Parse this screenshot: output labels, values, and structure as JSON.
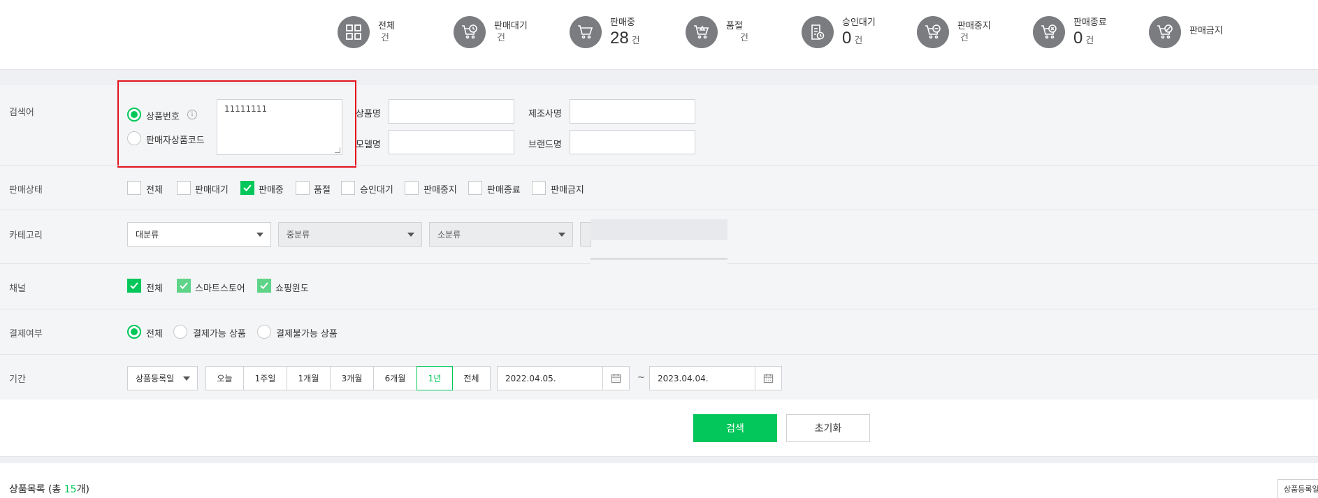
{
  "status_summary": [
    {
      "label": "전체",
      "value": "",
      "unit": "건",
      "icon": "grid-icon"
    },
    {
      "label": "판매대기",
      "value": "",
      "unit": "건",
      "icon": "cart-clock-icon"
    },
    {
      "label": "판매중",
      "value": "28",
      "unit": "건",
      "icon": "cart-icon"
    },
    {
      "label": "품절",
      "value": "",
      "unit": "건",
      "icon": "cart-soldout-icon"
    },
    {
      "label": "승인대기",
      "value": "0",
      "unit": "건",
      "icon": "doc-clock-icon"
    },
    {
      "label": "판매중지",
      "value": "",
      "unit": "건",
      "icon": "cart-minus-icon"
    },
    {
      "label": "판매종료",
      "value": "0",
      "unit": "건",
      "icon": "cart-x-icon"
    },
    {
      "label": "판매금지",
      "value": "",
      "unit": "",
      "icon": "cart-ban-icon"
    }
  ],
  "search": {
    "row_label": "검색어",
    "type_options": [
      {
        "label": "상품번호",
        "selected": true
      },
      {
        "label": "판매자상품코드",
        "selected": false
      }
    ],
    "product_number_value": "11111111",
    "fields": {
      "product_name_label": "상품명",
      "manufacturer_label": "제조사명",
      "model_name_label": "모델명",
      "brand_name_label": "브랜드명"
    }
  },
  "sale_status": {
    "row_label": "판매상태",
    "options": [
      {
        "label": "전체",
        "checked": false
      },
      {
        "label": "판매대기",
        "checked": false
      },
      {
        "label": "판매중",
        "checked": true
      },
      {
        "label": "품절",
        "checked": false
      },
      {
        "label": "승인대기",
        "checked": false
      },
      {
        "label": "판매중지",
        "checked": false
      },
      {
        "label": "판매종료",
        "checked": false
      },
      {
        "label": "판매금지",
        "checked": false
      }
    ]
  },
  "category": {
    "row_label": "카테고리",
    "large": "대분류",
    "medium": "중분류",
    "small": "소분류"
  },
  "channel": {
    "row_label": "채널",
    "options": [
      {
        "label": "전체",
        "checked": true
      },
      {
        "label": "스마트스토어",
        "checked": true
      },
      {
        "label": "쇼핑윈도",
        "checked": true
      }
    ]
  },
  "payment": {
    "row_label": "결제여부",
    "options": [
      {
        "label": "전체",
        "selected": true
      },
      {
        "label": "결제가능 상품",
        "selected": false
      },
      {
        "label": "결제불가능 상품",
        "selected": false
      }
    ]
  },
  "period": {
    "row_label": "기간",
    "date_type": "상품등록일",
    "buttons": [
      "오늘",
      "1주일",
      "1개월",
      "3개월",
      "6개월",
      "1년",
      "전체"
    ],
    "active_button": "1년",
    "start_date": "2022.04.05.",
    "separator": "~",
    "end_date": "2023.04.04."
  },
  "actions": {
    "search_label": "검색",
    "reset_label": "초기화"
  },
  "product_list": {
    "title_prefix": "상품목록 (총 ",
    "count": "15",
    "title_suffix": "개)",
    "sort_label": "상품등록일"
  },
  "colors": {
    "accent": "#03c75a",
    "highlight_border": "#e3141c",
    "icon_circle": "#7a7c80"
  }
}
